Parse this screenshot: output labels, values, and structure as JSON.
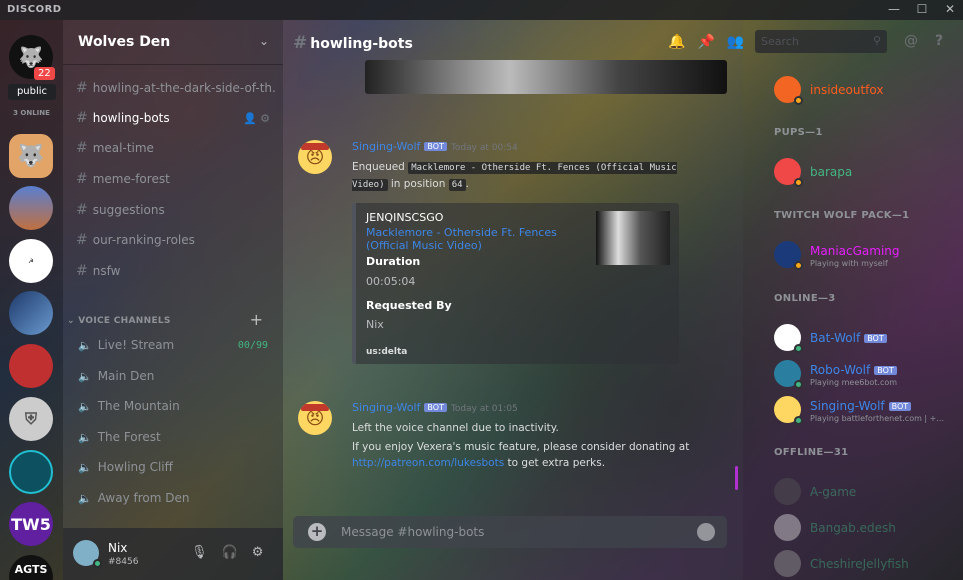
{
  "app": {
    "logo": "DISCORD",
    "win": {
      "min": "—",
      "max": "☐",
      "close": "✕"
    }
  },
  "guilds": {
    "badge": "22",
    "public_label": "public",
    "online_label": "3 ONLINE",
    "tw5": "TW5",
    "agts": "AGTS"
  },
  "server": {
    "name": "Wolves Den",
    "chevron": "⌄"
  },
  "text_channels": [
    {
      "name": "howling-at-the-dark-side-of-th..."
    },
    {
      "name": "howling-bots"
    },
    {
      "name": "meal-time"
    },
    {
      "name": "meme-forest"
    },
    {
      "name": "suggestions"
    },
    {
      "name": "our-ranking-roles"
    },
    {
      "name": "nsfw"
    }
  ],
  "voice": {
    "header": "VOICE CHANNELS",
    "plus": "+",
    "channels": [
      {
        "name": "Live! Stream",
        "limit": "00/99"
      },
      {
        "name": "Main Den"
      },
      {
        "name": "The Mountain"
      },
      {
        "name": "The Forest"
      },
      {
        "name": "Howling Cliff"
      },
      {
        "name": "Away from Den"
      }
    ]
  },
  "user": {
    "name": "Nix",
    "tag": "#8456"
  },
  "channel": {
    "hash": "#",
    "title": "howling-bots"
  },
  "search": {
    "placeholder": "Search"
  },
  "messages": [
    {
      "author": "Singing-Wolf",
      "bot": "BOT",
      "time": "Today at 00:54",
      "pre": "Enqueued",
      "track": "Macklemore - Otherside Ft. Fences (Official Music Video)",
      "mid": "in position",
      "position": "64",
      "post": ".",
      "embed": {
        "title": "JENQINSCSGO",
        "link": "Macklemore - Otherside Ft. Fences (Official Music Video)",
        "duration_label": "Duration",
        "duration": "00:05:04",
        "requested_label": "Requested By",
        "requested": "Nix",
        "footer": "us:delta"
      }
    },
    {
      "author": "Singing-Wolf",
      "bot": "BOT",
      "time": "Today at 01:05",
      "line1": "Left the voice channel due to inactivity.",
      "line2": "If you enjoy Vexera's music feature, please consider donating at",
      "link": "http://patreon.com/lukesbots",
      "line3": "to get extra perks."
    }
  ],
  "composer": {
    "placeholder": "Message #howling-bots"
  },
  "members": {
    "top": {
      "name": "insideoutfox"
    },
    "groups": [
      {
        "label": "PUPS—1",
        "members": [
          {
            "name": "barapa"
          }
        ]
      },
      {
        "label": "TWITCH WOLF PACK—1",
        "members": [
          {
            "name": "ManiacGaming",
            "sub": "Playing with myself"
          }
        ]
      },
      {
        "label": "ONLINE—3",
        "members": [
          {
            "name": "Bat-Wolf",
            "bot": "BOT"
          },
          {
            "name": "Robo-Wolf",
            "bot": "BOT",
            "sub": "Playing mee6bot.com"
          },
          {
            "name": "Singing-Wolf",
            "bot": "BOT",
            "sub": "Playing battleforthenet.com | +..."
          }
        ]
      },
      {
        "label": "OFFLINE—31",
        "members": [
          {
            "name": "A-game"
          },
          {
            "name": "Bangab.edesh"
          },
          {
            "name": "CheshireJellyfish"
          }
        ]
      }
    ]
  },
  "colors": {
    "accent": "#7289da",
    "online": "#43b581",
    "idle": "#faa61a",
    "dnd": "#f04747",
    "link": "#3e86e6",
    "streamer": "#e91eff",
    "orange_name": "#ff5c1f"
  }
}
